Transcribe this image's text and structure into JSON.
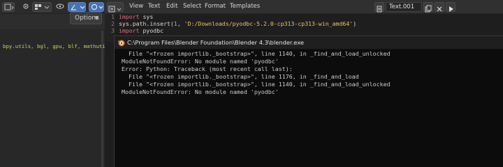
{
  "left_panel": {
    "options_label": "Options",
    "imports_text": "bpy.utils, bgl, gpu, blf, mathutil"
  },
  "editor": {
    "menu": [
      "View",
      "Text",
      "Edit",
      "Select",
      "Format",
      "Templates"
    ],
    "text_name": "Text.001",
    "lines": [
      {
        "num": "1",
        "code": "import sys"
      },
      {
        "num": "2",
        "code": "sys.path.insert(1, 'D:/Downloads/pyodbc-5.2.0-cp313-cp313-win_amd64')"
      },
      {
        "num": "3",
        "code": "import pyodbc"
      }
    ]
  },
  "console": {
    "title": "C:\\Program Files\\Blender Foundation\\Blender 4.3\\blender.exe",
    "lines": [
      "  File \"<frozen importlib._bootstrap>\", line 1140, in _find_and_load_unlocked",
      "ModuleNotFoundError: No module named 'pyodbc'",
      "Error: Python: Traceback (most recent call last):",
      "  File \"<frozen importlib._bootstrap>\", line 1176, in _find_and_load",
      "  File \"<frozen importlib._bootstrap>\", line 1140, in _find_and_load_unlocked",
      "ModuleNotFoundError: No module named 'pyodbc'"
    ]
  },
  "colors": {
    "keyword": "#e46b86",
    "string": "#e7c765",
    "number": "#8ab8e0",
    "console_bg": "#0c0c0c",
    "editor_bg": "#1e1e1e"
  }
}
